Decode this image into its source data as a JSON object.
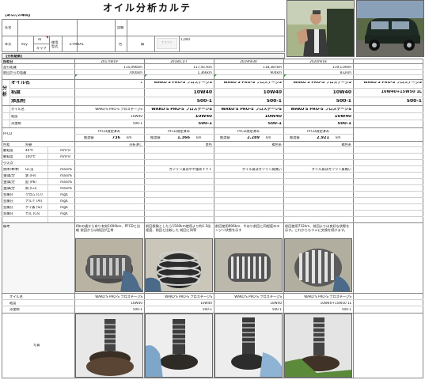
{
  "title": "オイル分析カルテ",
  "owner_label": "【あなたの車両】",
  "header": {
    "name_label": "氏名",
    "model_label": "車種",
    "year_label": "年式",
    "year_value": "92y",
    "trans_label": "AT",
    "trans_value": "キャブ",
    "engine_label": "使用型式",
    "engine_value": "E-99XA1",
    "test_label": "試験",
    "color_label": "色",
    "color_value": "緑",
    "check_label": "チェック",
    "mileage_value": "1,000"
  },
  "section_title": "【分析結果】",
  "columns": {
    "label": "採取日",
    "dates": [
      "2017/8/19",
      "2018/11/7",
      "2019/9/30",
      "2020/9/18"
    ]
  },
  "rows": {
    "odometer": {
      "label": "走行距離",
      "values": [
        "115,096km",
        "117,457km",
        "118,387km",
        "119,119km"
      ]
    },
    "since_last": {
      "label": "前回からの距離",
      "values": [
        "7000km",
        "1,366km",
        "904km",
        "832km"
      ]
    },
    "oil_name": {
      "label": "オイル名",
      "first": "-",
      "values": [
        "WAKO'S PRO-S プロステージS",
        "WAKO'S PRO-S プロステージS",
        "WAKO'S PRO-S プロステージS",
        "WAKO'S PRO-S プロステージS"
      ]
    },
    "viscosity": {
      "label": "粘度",
      "values": [
        "10W40",
        "10W40",
        "10W40",
        "10W40+15W50 1L"
      ]
    },
    "additive": {
      "label": "添加剤",
      "values": [
        "500-1",
        "500-1",
        "500-1",
        "500-1"
      ]
    },
    "oil_name2": {
      "label": "オイル名",
      "values": [
        "WAKO'S PRO-S プロステージS",
        "WAKO'S PRO-S プロステージS",
        "WAKO'S PRO-S プロステージS",
        "WAKO'S PRO-S プロステージS"
      ]
    },
    "viscosity2": {
      "label": "粘度",
      "values": [
        "10W40",
        "10W40",
        "10W40",
        "10W40"
      ]
    },
    "additive2": {
      "label": "添加剤",
      "values": [
        "500-1",
        "500-1",
        "500-1",
        "500-1"
      ]
    }
  },
  "oil_side_label": "分析",
  "pfcd": {
    "label": "PFCD",
    "status": [
      "PFCD測定済み",
      "PFCD測定済み",
      "PFCD測定済み",
      "PFCD測定済み"
    ],
    "unit_label": "推奨値",
    "values": [
      "736",
      "1.366",
      "2.289",
      "2.921"
    ],
    "unit": "km"
  },
  "results_labels": {
    "color": "色相",
    "odor": "外観",
    "visc40": "動粘度",
    "visc40_temp": "40℃",
    "visc100": "動粘度",
    "visc100_temp": "100℃",
    "unit_visc": "mm²/s",
    "flash": "引火点",
    "fuel": "燃料希釈",
    "fuel_val": "GC法",
    "fuel_unit": "mass%",
    "metal_fe": "金属分",
    "metal_fe_el": "鉄 (Fe)",
    "metal_pb": "金属分",
    "metal_pb_el": "鉛 (Pb)",
    "metal_cu": "金属分",
    "metal_cu_el": "銅 (Cu)",
    "metal_cr": "金属分",
    "metal_cr_el": "クロム (Cr)",
    "metal_al": "金属分",
    "metal_al_el": "アルミ (Al)",
    "metal_si": "金属分",
    "metal_si_el": "ケイ素 (Si)",
    "metal_ca": "金属分",
    "metal_ca_el": "カル (Ca)",
    "ppm": "mass%",
    "ppm2": "mg/L"
  },
  "appearance_values": [
    "分析済し",
    "良色",
    "褐色系",
    "褐色系"
  ],
  "fuel_notes": [
    "",
    "ガソリン臭はやや強めｔｔｃ",
    "オイル臭はガソリン臭無い",
    "オイル臭はガソリン臭無い"
  ],
  "remarks_label": "備考",
  "remarks": [
    "6年の歳から有り有効1000km、PFCDと比較 前回からは前回が正常",
    "前回保険としたら1500km使用より約1.5倍程度、前回と比較した 前回と同等",
    "前回使用906km、やはり前回と同程度のエンジン状態を示す",
    "前回使用732km、前回よりは良好な状態を示す。これからもマメに交換を続けます。"
  ],
  "bottom": {
    "oil_label": "オイル名",
    "visc_label": "粘度",
    "add_label": "添加剤",
    "oil_values": [
      "WAKO'S PRO-S プロステージS",
      "WAKO'S PRO-S プロステージS",
      "WAKO'S PRO-S プロステージS",
      "WAKO'S PRO-S プロステージS"
    ],
    "visc_values": [
      "10W40",
      "10W40",
      "10W40",
      "10W40+15W50 1L"
    ],
    "add_values": [
      "500-1",
      "500-1",
      "500-1",
      "500-1"
    ]
  },
  "photo_label": "写真",
  "colors": {
    "grid": "#888888",
    "header_bg": "#f2f2f2",
    "marker_green": "#2a8a3a",
    "marker_red": "#c0392b"
  }
}
